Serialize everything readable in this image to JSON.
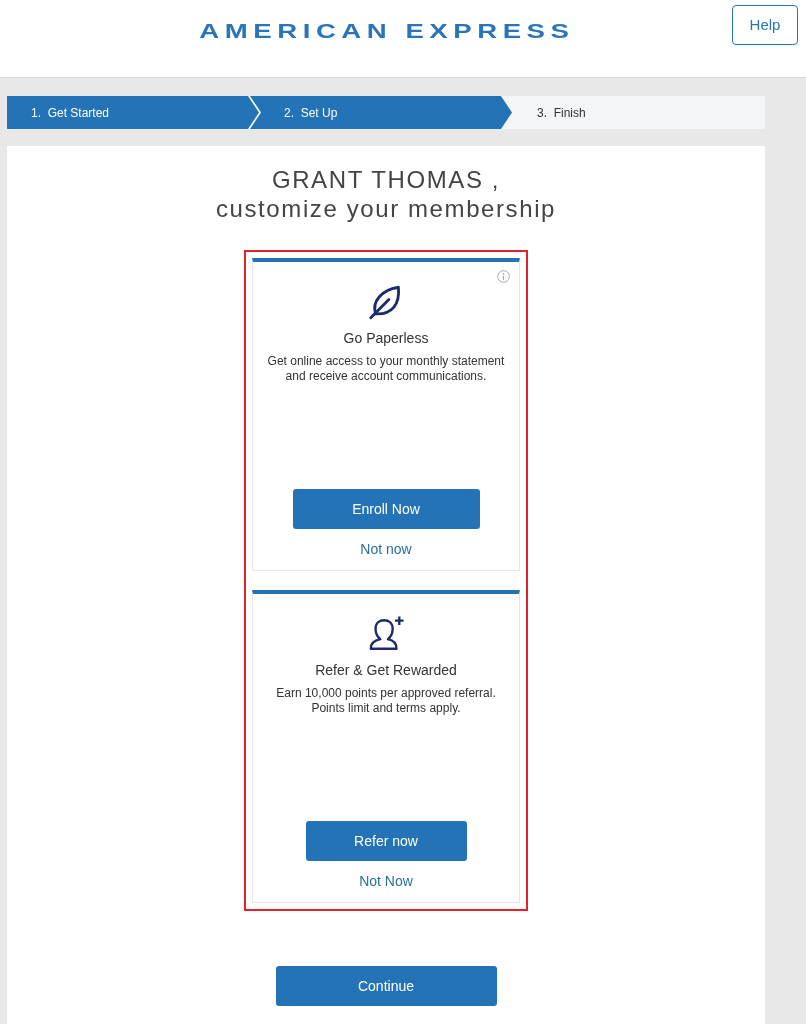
{
  "header": {
    "logo": "AMERICAN EXPRESS",
    "help_button": "Help"
  },
  "steps": [
    {
      "label": "1.  Get Started",
      "active": true
    },
    {
      "label": "2.  Set Up",
      "active": true
    },
    {
      "label": "3.  Finish",
      "active": false
    }
  ],
  "greeting": {
    "name": "GRANT THOMAS ,",
    "subtitle": "customize your membership"
  },
  "offers": {
    "highlighted": true,
    "items": [
      {
        "kind": "paperless",
        "info": true,
        "title": "Go Paperless",
        "description": "Get online access to your monthly statement and receive account communications.",
        "action": "Enroll Now",
        "dismiss": "Not now"
      },
      {
        "kind": "referral",
        "info": false,
        "title": "Refer & Get Rewarded",
        "description": "Earn 10,000 points per approved referral. Points limit and terms apply.",
        "action": "Refer now",
        "dismiss": "Not Now"
      }
    ]
  },
  "continue_button": "Continue"
}
